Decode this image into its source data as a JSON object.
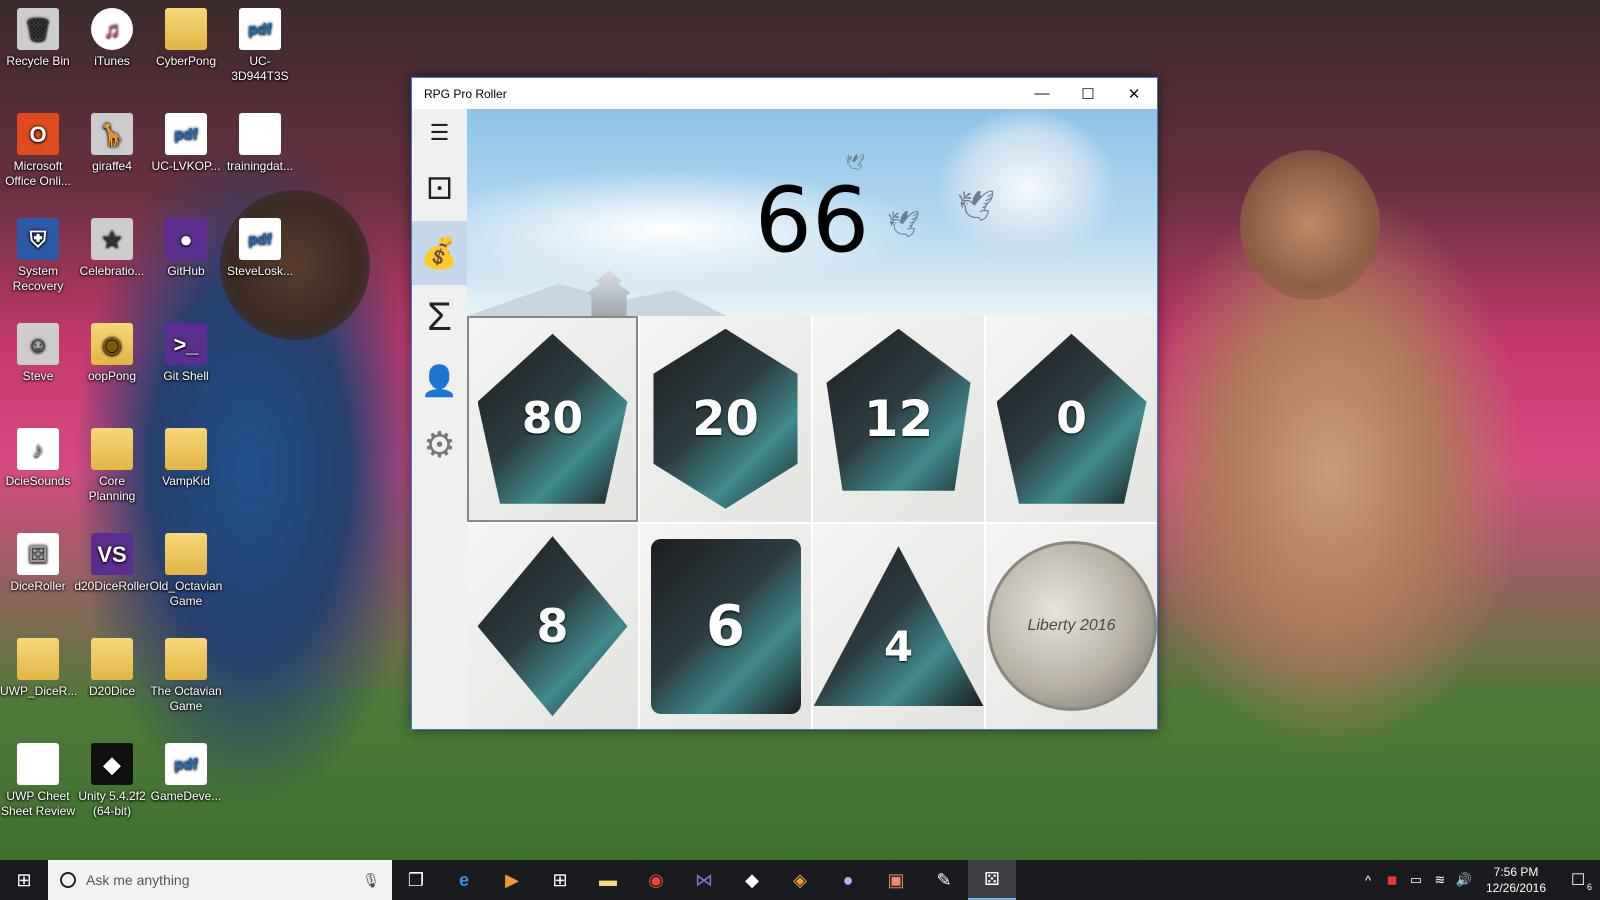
{
  "desktop": {
    "icons": [
      {
        "label": "Recycle Bin",
        "icon": "recycle-bin-icon",
        "glyph": "🗑"
      },
      {
        "label": "iTunes",
        "icon": "itunes-icon",
        "glyph": "♫"
      },
      {
        "label": "CyberPong",
        "icon": "folder-icon",
        "glyph": ""
      },
      {
        "label": "UC-3D944T3S",
        "icon": "pdf-icon",
        "glyph": "pdf"
      },
      {
        "label": "Microsoft Office Onli...",
        "icon": "office-icon",
        "glyph": "O"
      },
      {
        "label": "giraffe4",
        "icon": "image-icon",
        "glyph": "🦒"
      },
      {
        "label": "UC-LVKOP...",
        "icon": "pdf-icon",
        "glyph": "pdf"
      },
      {
        "label": "trainingdat...",
        "icon": "document-icon",
        "glyph": ""
      },
      {
        "label": "System Recovery",
        "icon": "shield-icon",
        "glyph": "⛨"
      },
      {
        "label": "Celebratio...",
        "icon": "image-icon",
        "glyph": "★"
      },
      {
        "label": "GitHub",
        "icon": "github-icon",
        "glyph": "●"
      },
      {
        "label": "SteveLosk...",
        "icon": "pdf-icon",
        "glyph": "pdf"
      },
      {
        "label": "Steve",
        "icon": "user-photo-icon",
        "glyph": "☺"
      },
      {
        "label": "oopPong",
        "icon": "chrome-icon",
        "glyph": "◉"
      },
      {
        "label": "Git Shell",
        "icon": "terminal-icon",
        "glyph": ">_"
      },
      {
        "label": "DcieSounds",
        "icon": "app-icon",
        "glyph": "♪"
      },
      {
        "label": "Core Planning",
        "icon": "folder-icon",
        "glyph": ""
      },
      {
        "label": "VampKid",
        "icon": "folder-icon",
        "glyph": ""
      },
      {
        "label": "DiceRoller",
        "icon": "app-icon",
        "glyph": "⚄"
      },
      {
        "label": "d20DiceRoller",
        "icon": "visual-studio-icon",
        "glyph": "VS"
      },
      {
        "label": "Old_Octavian Game",
        "icon": "folder-icon",
        "glyph": ""
      },
      {
        "label": "UWP_DiceR...",
        "icon": "folder-icon",
        "glyph": ""
      },
      {
        "label": "D20Dice",
        "icon": "folder-icon",
        "glyph": ""
      },
      {
        "label": "The Octavian Game",
        "icon": "folder-icon",
        "glyph": ""
      },
      {
        "label": "UWP Cheet Sheet Review",
        "icon": "document-icon",
        "glyph": ""
      },
      {
        "label": "Unity 5.4.2f2 (64-bit)",
        "icon": "unity-icon",
        "glyph": "◆"
      },
      {
        "label": "GameDeve...",
        "icon": "pdf-icon",
        "glyph": "pdf"
      }
    ]
  },
  "window": {
    "title": "RPG Pro Roller",
    "controls": {
      "minimize": "—",
      "maximize": "☐",
      "close": "✕"
    }
  },
  "sidebar": {
    "items": [
      {
        "name": "menu",
        "glyph": "☰",
        "active": false
      },
      {
        "name": "dice",
        "glyph": "⚀",
        "active": false
      },
      {
        "name": "bag",
        "glyph": "💰",
        "active": true
      },
      {
        "name": "sum",
        "glyph": "Σ",
        "active": false
      },
      {
        "name": "character",
        "glyph": "👤",
        "active": false
      },
      {
        "name": "settings",
        "glyph": "⚙",
        "active": false
      }
    ]
  },
  "roll": {
    "result": "66"
  },
  "dice": [
    {
      "type": "d100",
      "face": "80",
      "selected": true
    },
    {
      "type": "d20",
      "face": "20",
      "selected": false
    },
    {
      "type": "d12",
      "face": "12",
      "selected": false
    },
    {
      "type": "d10",
      "face": "0",
      "selected": false
    },
    {
      "type": "d8",
      "face": "8",
      "selected": false
    },
    {
      "type": "d6",
      "face": "6",
      "selected": false
    },
    {
      "type": "d4",
      "face": "4",
      "selected": false
    },
    {
      "type": "coin",
      "face": "Liberty 2016",
      "selected": false
    }
  ],
  "taskbar": {
    "search_placeholder": "Ask me anything",
    "apps": [
      "task-view",
      "edge",
      "media",
      "store",
      "file-explorer",
      "chrome",
      "visual-studio",
      "unity",
      "git",
      "github",
      "photos",
      "paint",
      "dice-roller"
    ],
    "time": "7:56 PM",
    "date": "12/26/2016",
    "notifications": "6"
  }
}
